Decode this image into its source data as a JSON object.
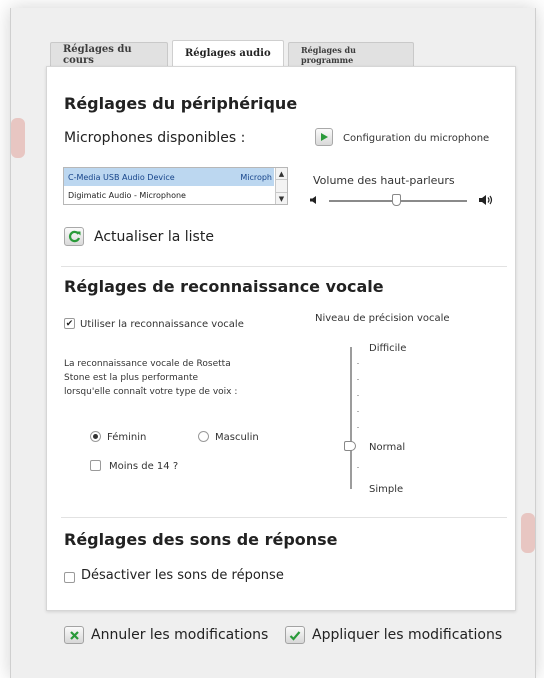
{
  "tabs": [
    {
      "label": "Réglages du cours"
    },
    {
      "label": "Réglages audio"
    },
    {
      "label": "Réglages du programme"
    }
  ],
  "device": {
    "title": "Réglages du périphérique",
    "mics_label": "Microphones disponibles :",
    "mic_config_label": "Configuration du microphone",
    "microphones": [
      {
        "name": "C-Media USB Audio Device",
        "detail": "Microph"
      },
      {
        "name": "Digimatic Audio - Microphone",
        "detail": ""
      }
    ],
    "volume_label": "Volume des haut-parleurs",
    "volume_level": 0.5,
    "refresh_label": "Actualiser la liste"
  },
  "speech": {
    "title": "Réglages de reconnaissance vocale",
    "use_label": "Utiliser la reconnaissance vocale",
    "use_checked": true,
    "desc": "La reconnaissance vocale de Rosetta Stone est la plus performante lorsqu'elle connaît votre type de voix :",
    "gender_female": "Féminin",
    "gender_male": "Masculin",
    "selected_gender": "Féminin",
    "under14_label": "Moins de 14 ?",
    "precision_label": "Niveau de précision vocale",
    "levels": [
      "Difficile",
      "Normal",
      "Simple"
    ],
    "selected_level": "Normal"
  },
  "feedback": {
    "title": "Réglages des sons de réponse",
    "disable_label": "Désactiver les sons de réponse",
    "disable_checked": false
  },
  "footer": {
    "cancel_label": "Annuler les modifications",
    "apply_label": "Appliquer les modifications"
  },
  "colors": {
    "accent_green": "#2a9a3a",
    "selection_blue": "#bcd7f0"
  }
}
